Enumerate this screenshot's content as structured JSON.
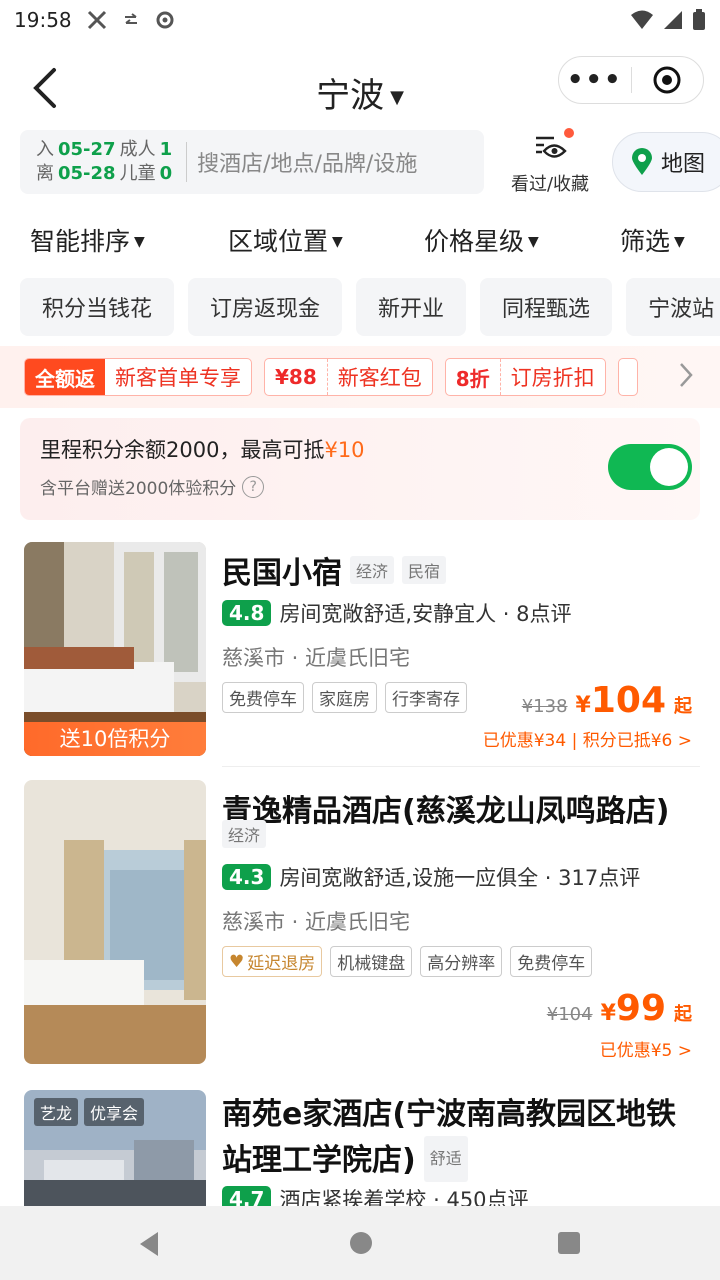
{
  "status": {
    "time": "19:58"
  },
  "header": {
    "city": "宁波"
  },
  "search": {
    "checkin_label": "入",
    "checkin_date": "05-27",
    "checkout_label": "离",
    "checkout_date": "05-28",
    "adults_label": "成人",
    "adults": "1",
    "children_label": "儿童",
    "children": "0",
    "placeholder": "搜酒店/地点/品牌/设施",
    "history_label": "看过/收藏",
    "map_label": "地图"
  },
  "sort": [
    "智能排序",
    "区域位置",
    "价格星级",
    "筛选"
  ],
  "chips": [
    "积分当钱花",
    "订房返现金",
    "新开业",
    "同程甄选",
    "宁波站"
  ],
  "promos": [
    {
      "tag": "全额返",
      "desc": "新客首单专享"
    },
    {
      "tag": "¥88",
      "desc": "新客红包"
    },
    {
      "tag": "8折",
      "desc": "订房折扣"
    }
  ],
  "miles": {
    "text": "里程积分余额2000，最高可抵",
    "amount": "¥10",
    "sub": "含平台赠送2000体验积分",
    "enabled": true
  },
  "hotels": [
    {
      "name": "民国小宿",
      "tags": [
        "经济",
        "民宿"
      ],
      "score": "4.8",
      "review": "房间宽敞舒适,安静宜人 · 8点评",
      "location": "慈溪市 · 近虞氏旧宅",
      "features": [
        "免费停车",
        "家庭房",
        "行李寄存"
      ],
      "orig_price": "¥138",
      "price": "104",
      "suffix": "起",
      "discount": "已优惠¥34 | 积分已抵¥6 >",
      "badge": "送10倍积分"
    },
    {
      "name": "青逸精品酒店(慈溪龙山凤鸣路店)",
      "tags": [
        "经济"
      ],
      "score": "4.3",
      "review": "房间宽敞舒适,设施一应俱全 · 317点评",
      "location": "慈溪市 · 近虞氏旧宅",
      "features": [
        "延迟退房",
        "机械键盘",
        "高分辨率",
        "免费停车"
      ],
      "orig_price": "¥104",
      "price": "99",
      "suffix": "起",
      "discount": "已优惠¥5 >"
    },
    {
      "name_line1": "南苑e家酒店(宁波南高教园区地铁",
      "name_line2": "站理工学院店)",
      "tags": [
        "舒适"
      ],
      "score": "4.7",
      "review": "酒店紧挨着学校 · 450点评",
      "badges": [
        "艺龙",
        "优享会"
      ]
    }
  ],
  "colors": {
    "brand_green": "#0ea04b",
    "price_orange": "#ff5a00",
    "promo_red": "#ff4a1f"
  }
}
